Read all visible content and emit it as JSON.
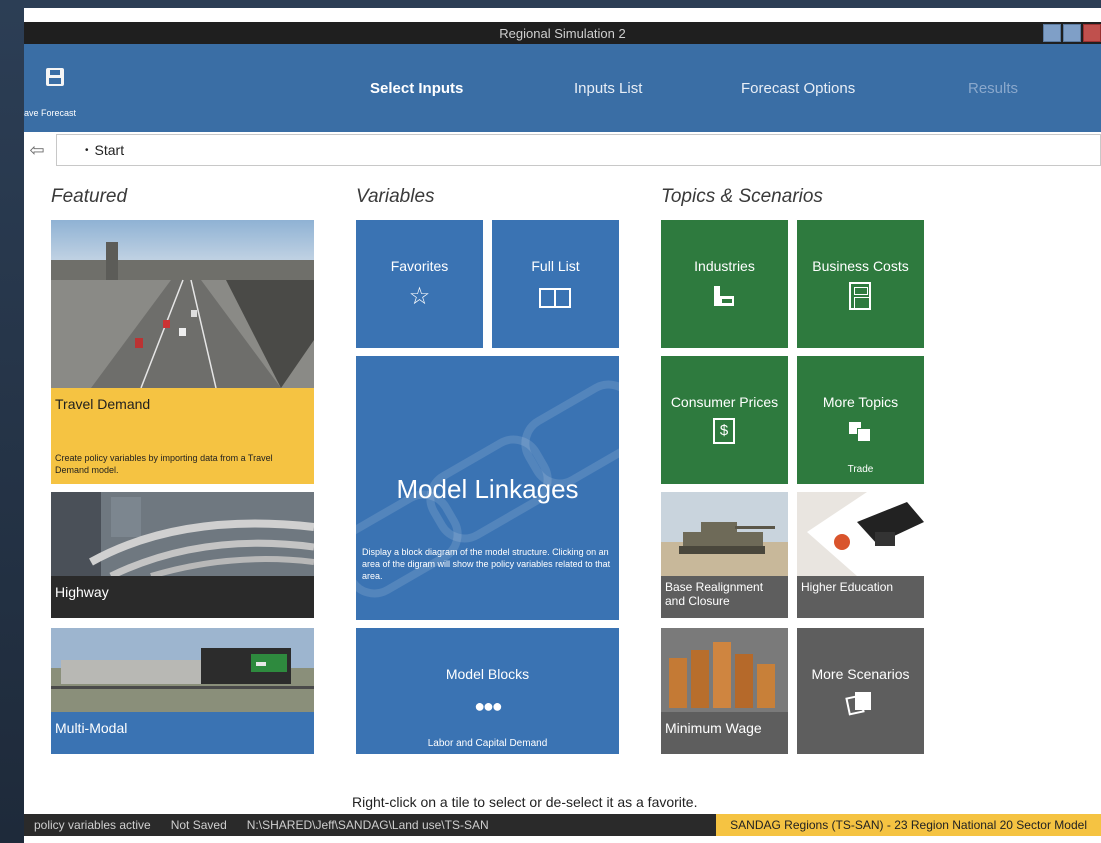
{
  "window": {
    "title": "Regional Simulation 2"
  },
  "ribbon": {
    "save_label": "ave Forecast",
    "tabs": [
      {
        "label": "Select Inputs"
      },
      {
        "label": "Inputs List"
      },
      {
        "label": "Forecast Options"
      },
      {
        "label": "Results"
      }
    ]
  },
  "breadcrumb": {
    "item": "Start"
  },
  "sections": {
    "featured": "Featured",
    "variables": "Variables",
    "topics": "Topics & Scenarios"
  },
  "featured": {
    "travel_demand": {
      "title": "Travel Demand",
      "desc": "Create policy variables by importing data from a Travel Demand model."
    },
    "highway": {
      "title": "Highway"
    },
    "multimodal": {
      "title": "Multi-Modal"
    }
  },
  "variables": {
    "favorites": "Favorites",
    "full_list": "Full List",
    "model_linkages": {
      "title": "Model Linkages",
      "desc": "Display a block diagram of the model structure. Clicking on an area of the digram will show the policy variables related to that area."
    },
    "model_blocks": {
      "title": "Model Blocks",
      "sub": "Labor and Capital Demand"
    }
  },
  "topics": {
    "industries": "Industries",
    "business_costs": "Business Costs",
    "consumer_prices": "Consumer Prices",
    "more_topics": {
      "title": "More Topics",
      "sub": "Trade"
    },
    "base_realignment": "Base Realignment and Closure",
    "higher_education": "Higher Education",
    "minimum_wage": "Minimum Wage",
    "more_scenarios": "More Scenarios"
  },
  "hint": "Right-click on a tile to select or de-select it as a favorite.",
  "status": {
    "variables": "policy variables active",
    "saved": "Not Saved",
    "path": "N:\\SHARED\\Jeff\\SANDAG\\Land use\\TS-SAN",
    "region": "SANDAG Regions (TS-SAN) -  23 Region National 20 Sector Model"
  },
  "colors": {
    "ribbon": "#3a6ea5",
    "tile_blue": "#3a73b3",
    "tile_green": "#2e7a3e",
    "tile_gray": "#5e5e5e",
    "tile_yellow": "#f5c342",
    "status_region": "#f5c342"
  },
  "icons": {
    "save": "floppy-disk-icon",
    "back": "back-arrow-icon",
    "favorites": "star-icon",
    "full_list": "book-icon",
    "industries": "factory-icon",
    "business_costs": "calculator-icon",
    "consumer_prices": "dollar-receipt-icon",
    "more_topics": "trade-icon",
    "model_blocks": "people-icon",
    "more_scenarios": "scenario-icon"
  }
}
